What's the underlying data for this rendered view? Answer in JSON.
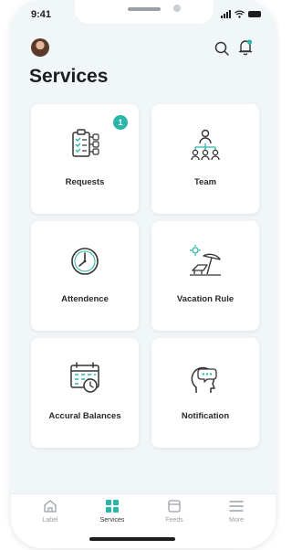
{
  "status_bar": {
    "time": "9:41"
  },
  "header": {
    "title": "Services"
  },
  "services": [
    {
      "label": "Requests",
      "icon": "clipboard-checklist-icon",
      "badge": "1"
    },
    {
      "label": "Team",
      "icon": "team-hierarchy-icon"
    },
    {
      "label": "Attendence",
      "icon": "clock-icon"
    },
    {
      "label": "Vacation Rule",
      "icon": "beach-umbrella-icon"
    },
    {
      "label": "Accural Balances",
      "icon": "calendar-clock-icon"
    },
    {
      "label": "Notification",
      "icon": "head-chat-icon"
    }
  ],
  "tab_bar": {
    "items": [
      {
        "label": "Label",
        "icon": "home-icon"
      },
      {
        "label": "Services",
        "icon": "grid-icon",
        "active": true
      },
      {
        "label": "Feeds",
        "icon": "feed-icon"
      },
      {
        "label": "More",
        "icon": "menu-icon"
      }
    ]
  },
  "colors": {
    "accent": "#2ab7a9",
    "background": "#f1f6f8",
    "card": "#ffffff",
    "text": "#1d1d1f"
  }
}
